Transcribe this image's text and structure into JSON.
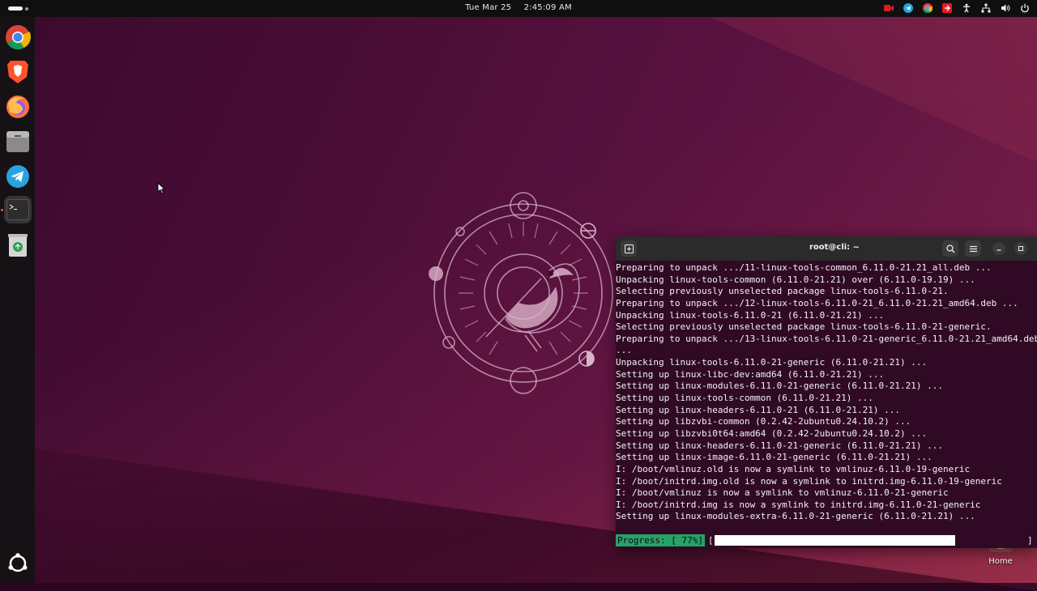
{
  "topbar": {
    "date": "Tue Mar 25",
    "time": "2:45:09 AM",
    "tray_icons": [
      "screen-record-icon",
      "telegram-tray-icon",
      "chrome-tray-icon",
      "screencast-icon",
      "accessibility-icon",
      "network-icon",
      "volume-icon",
      "power-icon"
    ]
  },
  "dock": {
    "items": [
      "chrome-icon",
      "brave-icon",
      "firefox-icon",
      "files-icon",
      "telegram-icon",
      "terminal-icon",
      "trash-icon",
      "show-apps-icon"
    ]
  },
  "terminal": {
    "title": "root@cli: ~",
    "lines": [
      "Preparing to unpack .../11-linux-tools-common_6.11.0-21.21_all.deb ...",
      "Unpacking linux-tools-common (6.11.0-21.21) over (6.11.0-19.19) ...",
      "Selecting previously unselected package linux-tools-6.11.0-21.",
      "Preparing to unpack .../12-linux-tools-6.11.0-21_6.11.0-21.21_amd64.deb ...",
      "Unpacking linux-tools-6.11.0-21 (6.11.0-21.21) ...",
      "Selecting previously unselected package linux-tools-6.11.0-21-generic.",
      "Preparing to unpack .../13-linux-tools-6.11.0-21-generic_6.11.0-21.21_amd64.deb",
      "...",
      "Unpacking linux-tools-6.11.0-21-generic (6.11.0-21.21) ...",
      "Setting up linux-libc-dev:amd64 (6.11.0-21.21) ...",
      "Setting up linux-modules-6.11.0-21-generic (6.11.0-21.21) ...",
      "Setting up linux-tools-common (6.11.0-21.21) ...",
      "Setting up linux-headers-6.11.0-21 (6.11.0-21.21) ...",
      "Setting up libzvbi-common (0.2.42-2ubuntu0.24.10.2) ...",
      "Setting up libzvbi0t64:amd64 (0.2.42-2ubuntu0.24.10.2) ...",
      "Setting up linux-headers-6.11.0-21-generic (6.11.0-21.21) ...",
      "Setting up linux-image-6.11.0-21-generic (6.11.0-21.21) ...",
      "I: /boot/vmlinuz.old is now a symlink to vmlinuz-6.11.0-19-generic",
      "I: /boot/initrd.img.old is now a symlink to initrd.img-6.11.0-19-generic",
      "I: /boot/vmlinuz is now a symlink to vmlinuz-6.11.0-21-generic",
      "I: /boot/initrd.img is now a symlink to initrd.img-6.11.0-21-generic",
      "Setting up linux-modules-extra-6.11.0-21-generic (6.11.0-21.21) ..."
    ],
    "progress_label": "Progress: [ 77%]",
    "progress_open": "[",
    "progress_close": "]",
    "progress_fraction": 0.77
  },
  "desktop": {
    "home_label": "Home"
  },
  "colors": {
    "terminal_bg": "#300a24",
    "progress_green": "#26a269",
    "accent": "#e95420"
  }
}
